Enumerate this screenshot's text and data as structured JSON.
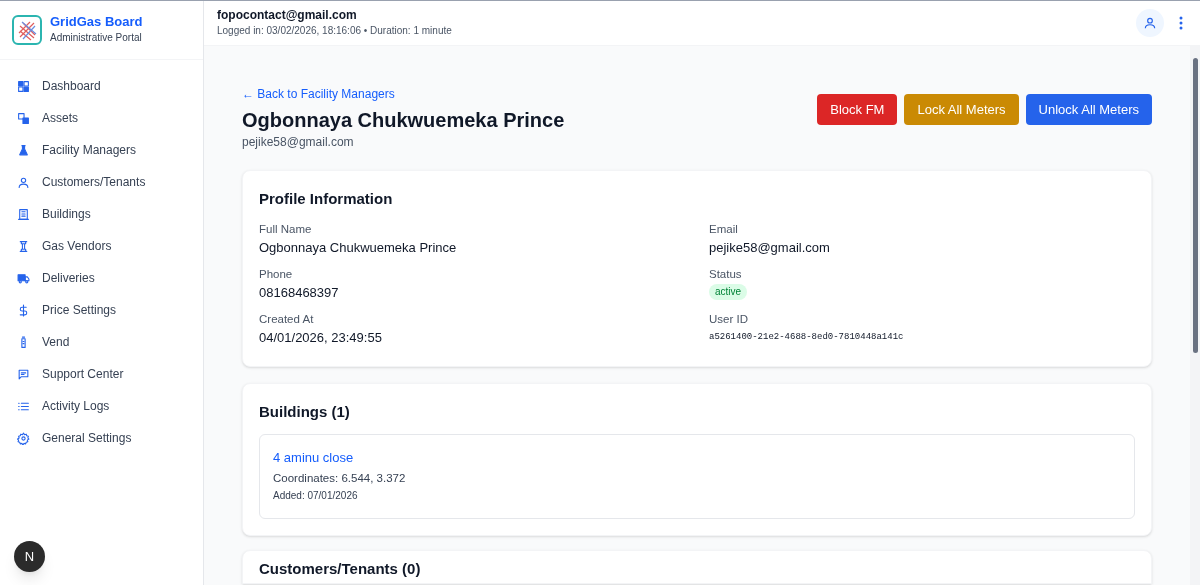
{
  "brand": {
    "title": "GridGas Board",
    "subtitle": "Administrative Portal"
  },
  "sidebar": {
    "items": [
      {
        "label": "Dashboard"
      },
      {
        "label": "Assets"
      },
      {
        "label": "Facility Managers"
      },
      {
        "label": "Customers/Tenants"
      },
      {
        "label": "Buildings"
      },
      {
        "label": "Gas Vendors"
      },
      {
        "label": "Deliveries"
      },
      {
        "label": "Price Settings"
      },
      {
        "label": "Vend"
      },
      {
        "label": "Support Center"
      },
      {
        "label": "Activity Logs"
      },
      {
        "label": "General Settings"
      }
    ]
  },
  "dev_badge": "N",
  "header": {
    "email": "fopocontact@gmail.com",
    "session": "Logged in: 03/02/2026, 18:16:06 • Duration: 1 minute"
  },
  "back_link": "← Back to Facility Managers",
  "manager": {
    "name": "Ogbonnaya Chukwuemeka Prince",
    "email": "pejike58@gmail.com"
  },
  "actions": [
    {
      "label": "Block FM",
      "kind": "danger"
    },
    {
      "label": "Lock All Meters",
      "kind": "warning"
    },
    {
      "label": "Unlock All Meters",
      "kind": "primary"
    }
  ],
  "profile": {
    "title": "Profile Information",
    "fields": [
      {
        "label": "Full Name",
        "value": "Ogbonnaya Chukwuemeka Prince",
        "kind": "text"
      },
      {
        "label": "Email",
        "value": "pejike58@gmail.com",
        "kind": "text"
      },
      {
        "label": "Phone",
        "value": "08168468397",
        "kind": "text"
      },
      {
        "label": "Status",
        "value": "active",
        "kind": "badge"
      },
      {
        "label": "Created At",
        "value": "04/01/2026, 23:49:55",
        "kind": "text"
      },
      {
        "label": "User ID",
        "value": "a5261400-21e2-4688-8ed0-7810448a141c",
        "kind": "code"
      }
    ]
  },
  "buildings": {
    "title": "Buildings (1)",
    "items": [
      {
        "name": "4 aminu close",
        "coordinates": "Coordinates: 6.544, 3.372",
        "added": "Added: 07/01/2026"
      }
    ]
  },
  "customers": {
    "title": "Customers/Tenants (0)"
  }
}
